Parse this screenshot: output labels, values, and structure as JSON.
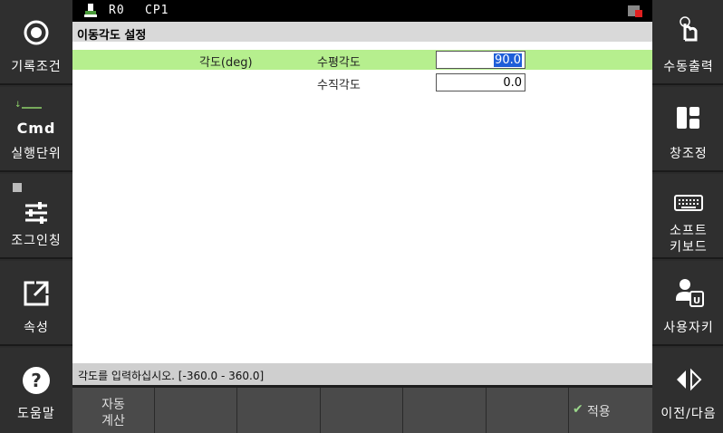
{
  "status": {
    "robot": "R0",
    "cp": "CP1"
  },
  "title": "이동각도 설정",
  "rows": [
    {
      "group_label": "각도(deg)",
      "label": "수평각도",
      "value": "90.0"
    },
    {
      "group_label": "",
      "label": "수직각도",
      "value": "0.0"
    }
  ],
  "hint": "각도를 입력하십시오. [-360.0 - 360.0]",
  "left_menu": [
    "기록조건",
    "Cmd",
    "실행단위",
    "조그인칭",
    "속성",
    "도움말"
  ],
  "right_menu": [
    "수동출력",
    "창조정",
    "소프트",
    "키보드",
    "사용자키",
    "이전/다음"
  ],
  "bottom": {
    "auto_calc_1": "자동",
    "auto_calc_2": "계산",
    "apply": "적용"
  },
  "colors": {
    "highlight": "#b6ef8e",
    "selection": "#1e5ed8"
  }
}
